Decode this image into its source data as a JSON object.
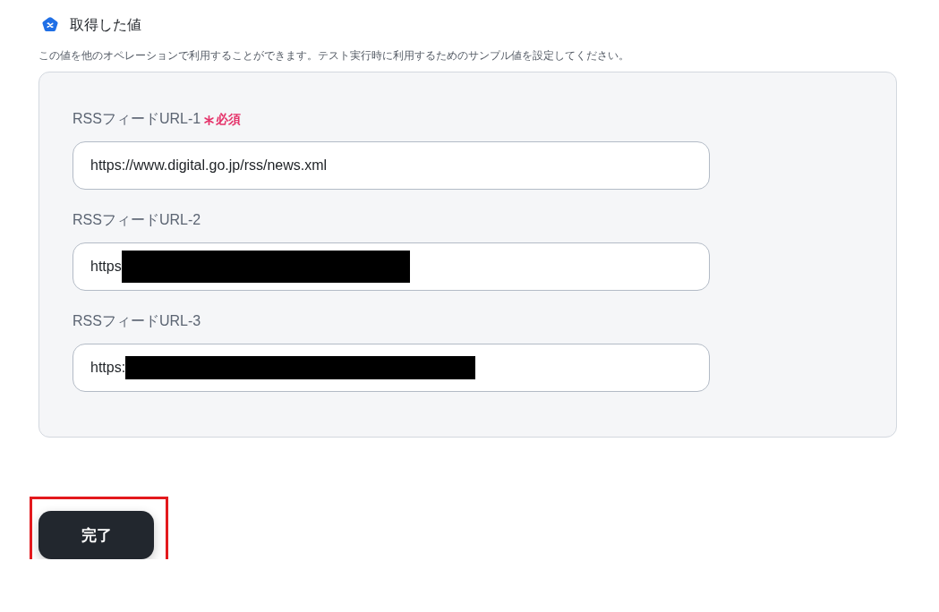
{
  "section": {
    "title": "取得した値",
    "description": "この値を他のオペレーションで利用することができます。テスト実行時に利用するためのサンプル値を設定してください。"
  },
  "fields": [
    {
      "label": "RSSフィードURL-1",
      "required": true,
      "required_label": "必須",
      "value": "https://www.digital.go.jp/rss/news.xml",
      "redacted": false
    },
    {
      "label": "RSSフィードURL-2",
      "required": false,
      "value": "https",
      "redacted": true
    },
    {
      "label": "RSSフィードURL-3",
      "required": false,
      "value": "https:",
      "redacted": true
    }
  ],
  "button": {
    "label": "完了",
    "highlighted": true
  }
}
